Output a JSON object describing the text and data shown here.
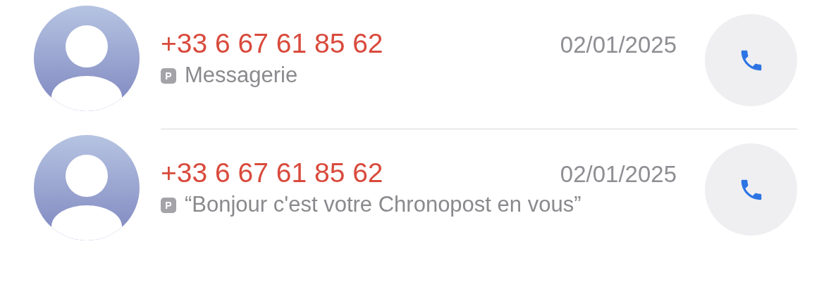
{
  "calls": [
    {
      "number": "+33 6 67 61 85 62",
      "missed": true,
      "date": "02/01/2025",
      "badge": "P",
      "message": "Messagerie"
    },
    {
      "number": "+33 6 67 61 85 62",
      "missed": true,
      "date": "02/01/2025",
      "badge": "P",
      "message": "“Bonjour c'est votre Chronopost en vous”"
    }
  ]
}
